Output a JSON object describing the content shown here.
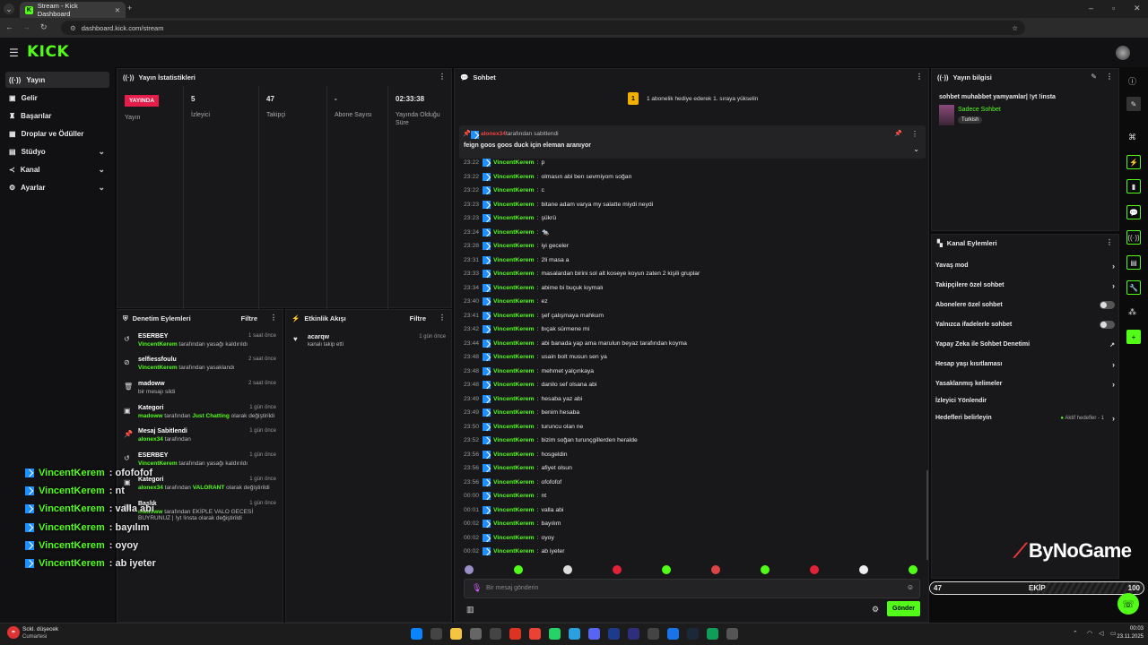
{
  "browser": {
    "tab_title": "Stream - Kick Dashboard",
    "url": "dashboard.kick.com/stream"
  },
  "brand": {
    "logo": "KICK",
    "accent": "#53fc18"
  },
  "sidebar": {
    "items": [
      {
        "label": "Yayın",
        "icon": "broadcast-icon",
        "active": true
      },
      {
        "label": "Gelir",
        "icon": "wallet-icon"
      },
      {
        "label": "Başarılar",
        "icon": "trophy-icon"
      },
      {
        "label": "Droplar ve Ödüller",
        "icon": "gift-icon"
      },
      {
        "label": "Stüdyo",
        "icon": "studio-icon",
        "expandable": true
      },
      {
        "label": "Kanal",
        "icon": "channel-icon",
        "expandable": true
      },
      {
        "label": "Ayarlar",
        "icon": "gear-icon",
        "expandable": true
      }
    ]
  },
  "stats": {
    "title": "Yayın İstatistikleri",
    "live_badge": "YAYINDA",
    "live_label": "Yayın",
    "viewers": "5",
    "viewers_label": "İzleyici",
    "followers": "47",
    "followers_label": "Takipçi",
    "subs": "-",
    "subs_label": "Abone Sayısı",
    "duration": "02:33:38",
    "duration_label": "Yayında Olduğu Süre"
  },
  "mod_actions": {
    "title": "Denetim Eylemleri",
    "filter": "Filtre",
    "items": [
      {
        "title": "ESERBEY",
        "user": "VincentKerem",
        "text": " tarafından yasağı kaldırıldı",
        "time": "1 saat önce",
        "icon": "unban-icon"
      },
      {
        "title": "selfiessfoulu",
        "user": "VincentKerem",
        "text": " tarafından yasaklandı",
        "time": "2 saat önce",
        "icon": "ban-icon"
      },
      {
        "title": "madoww",
        "user": "",
        "text": "bir mesajı sildi",
        "time": "2 saat önce",
        "icon": "trash-icon"
      },
      {
        "title": "Kategori",
        "user": "madoww",
        "text": " tarafından ",
        "extra": "Just Chatting",
        "tail": " olarak değiştirildi",
        "time": "1 gün önce",
        "icon": "category-icon"
      },
      {
        "title": "Mesaj Sabitlendi",
        "user": "alonex34",
        "text": " tarafından",
        "time": "1 gün önce",
        "icon": "pin-icon"
      },
      {
        "title": "ESERBEY",
        "user": "VincentKerem",
        "text": " tarafından yasağı kaldırıldı",
        "time": "1 gün önce",
        "icon": "unban-icon"
      },
      {
        "title": "Kategori",
        "user": "alonex34",
        "text": " tarafından ",
        "extra": "VALORANT",
        "tail": " olarak değiştirildi",
        "time": "1 gün önce",
        "icon": "category-icon"
      },
      {
        "title": "Başlık",
        "user": "madoww",
        "text": " tarafından EKİPLE VALO GECESİ BUYRUNUZ | !yt !insta olarak değiştirildi",
        "time": "1 gün önce",
        "icon": "title-icon"
      }
    ]
  },
  "activity": {
    "title": "Etkinlik Akışı",
    "filter": "Filtre",
    "items": [
      {
        "user": "acarqw",
        "text": "kanalı takip etti",
        "time": "1 gün önce"
      }
    ]
  },
  "chat": {
    "title": "Sohbet",
    "gift_banner": "1 abonelik hediye ederek 1. sıraya yükselin",
    "gift_rank": "1",
    "pinned_by": "alonex34",
    "pinned_by_text": "tarafından sabitlendi",
    "pinned_msg": "feign goos goos duck için eleman aranıyor",
    "messages": [
      {
        "t": "23:22",
        "u": "VincentKerem",
        "m": "p"
      },
      {
        "t": "23:22",
        "u": "VincentKerem",
        "m": "olmasın abi ben sevmiyom soğan"
      },
      {
        "t": "23:22",
        "u": "VincentKerem",
        "m": "c"
      },
      {
        "t": "23:23",
        "u": "VincentKerem",
        "m": "bitane adam varya my salatte miydi neydi"
      },
      {
        "t": "23:23",
        "u": "VincentKerem",
        "m": "şükrü"
      },
      {
        "t": "23:24",
        "u": "VincentKerem",
        "m": "🐀"
      },
      {
        "t": "23:28",
        "u": "VincentKerem",
        "m": "iyi geceler"
      },
      {
        "t": "23:31",
        "u": "VincentKerem",
        "m": "2li masa a"
      },
      {
        "t": "23:33",
        "u": "VincentKerem",
        "m": "masalardan birini sol alt koseye koyun zaten 2 kişili gruplar"
      },
      {
        "t": "23:34",
        "u": "VincentKerem",
        "m": "abime bi buçuk kıymalı"
      },
      {
        "t": "23:40",
        "u": "VincentKerem",
        "m": "ez"
      },
      {
        "t": "23:41",
        "u": "VincentKerem",
        "m": "şef çalışmaya mahkum"
      },
      {
        "t": "23:42",
        "u": "VincentKerem",
        "m": "bıçak sürmene mi"
      },
      {
        "t": "23:44",
        "u": "VincentKerem",
        "m": "abi banada yap ama marulun beyaz tarafından koyma"
      },
      {
        "t": "23:48",
        "u": "VincentKerem",
        "m": "usain bolt musun sen ya"
      },
      {
        "t": "23:48",
        "u": "VincentKerem",
        "m": "mehmet yalçınkaya"
      },
      {
        "t": "23:48",
        "u": "VincentKerem",
        "m": "danilo sef olsana abi"
      },
      {
        "t": "23:49",
        "u": "VincentKerem",
        "m": "hesaba yaz abi"
      },
      {
        "t": "23:49",
        "u": "VincentKerem",
        "m": "benim hesaba"
      },
      {
        "t": "23:50",
        "u": "VincentKerem",
        "m": "turuncu olan ne"
      },
      {
        "t": "23:52",
        "u": "VincentKerem",
        "m": "bizim soğan turunçgillerden heralde"
      },
      {
        "t": "23:56",
        "u": "VincentKerem",
        "m": "hosgeldin"
      },
      {
        "t": "23:56",
        "u": "VincentKerem",
        "m": "afiyet olsun"
      },
      {
        "t": "23:56",
        "u": "VincentKerem",
        "m": "ofofofof"
      },
      {
        "t": "00:00",
        "u": "VincentKerem",
        "m": "nt"
      },
      {
        "t": "00:01",
        "u": "VincentKerem",
        "m": "valla abi"
      },
      {
        "t": "00:02",
        "u": "VincentKerem",
        "m": "bayılım"
      },
      {
        "t": "00:02",
        "u": "VincentKerem",
        "m": "oyoy"
      },
      {
        "t": "00:02",
        "u": "VincentKerem",
        "m": "ab iyeter"
      }
    ],
    "input_placeholder": "Bir mesaj gönderin",
    "send_label": "Gönder"
  },
  "stream_info": {
    "title": "Yayın bilgisi",
    "stream_title": "sohbet muhabbet yamyamlar| !yt !insta",
    "category": "Sadece Sohbet",
    "tag": "Turkish"
  },
  "channel_actions": {
    "title": "Kanal Eylemleri",
    "items": [
      {
        "label": "Yavaş mod",
        "control": "arrow"
      },
      {
        "label": "Takipçilere özel sohbet",
        "control": "arrow"
      },
      {
        "label": "Abonelere özel sohbet",
        "control": "toggle"
      },
      {
        "label": "Yalnızca ifadelerle sohbet",
        "control": "toggle"
      },
      {
        "label": "Yapay Zeka ile Sohbet Denetimi",
        "control": "external"
      },
      {
        "label": "Hesap yaşı kısıtlaması",
        "control": "arrow"
      },
      {
        "label": "Yasaklanmış kelimeler",
        "control": "arrow"
      },
      {
        "label": "İzleyici Yönlendir",
        "control": "none"
      },
      {
        "label": "Hedefleri belirleyin",
        "control": "arrow",
        "status": "Aktif hedefler - 1"
      }
    ]
  },
  "overlay": {
    "messages": [
      {
        "u": "VincentKerem",
        "m": ": ofofofof"
      },
      {
        "u": "VincentKerem",
        "m": ": nt"
      },
      {
        "u": "VincentKerem",
        "m": ": valla abi"
      },
      {
        "u": "VincentKerem",
        "m": ": bayılım"
      },
      {
        "u": "VincentKerem",
        "m": ": oyoy"
      },
      {
        "u": "VincentKerem",
        "m": ": ab iyeter"
      }
    ],
    "sponsor": "ByNoGame",
    "goal_current": "47",
    "goal_label": "EKİP",
    "goal_target": "100"
  },
  "taskbar": {
    "weather": "Sckl. düşecek",
    "weather_day": "Cumartesi",
    "time": "00:03",
    "date": "23.11.2025"
  }
}
